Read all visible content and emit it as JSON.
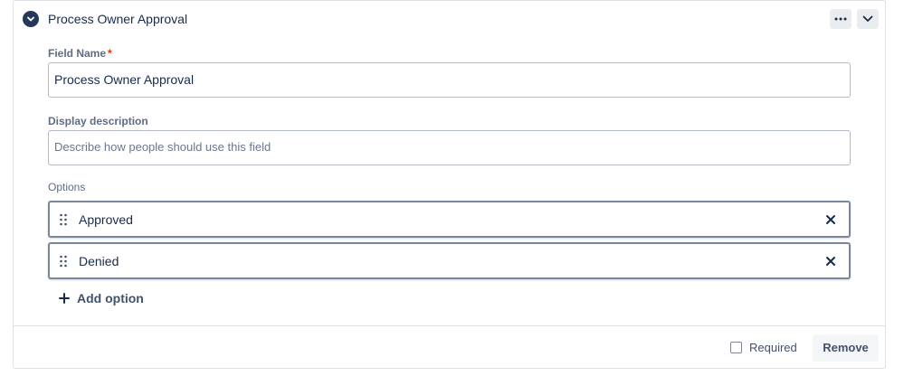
{
  "section": {
    "title": "Process Owner Approval",
    "more_icon": "more-horizontal-icon",
    "chevron_icon": "chevron-down-icon",
    "collapse_icon": "chevron-down-circle-icon"
  },
  "field_name": {
    "label": "Field Name",
    "required_mark": "*",
    "value": "Process Owner Approval"
  },
  "display_description": {
    "label": "Display description",
    "placeholder": "Describe how people should use this field"
  },
  "options": {
    "label": "Options",
    "items": [
      {
        "label": "Approved"
      },
      {
        "label": "Denied"
      }
    ],
    "add_label": "Add option"
  },
  "footer": {
    "required_label": "Required",
    "required_checked": false,
    "remove_label": "Remove"
  },
  "colors": {
    "accent_dark": "#253858",
    "required_star": "#de350b",
    "text": "#172b4d",
    "muted": "#5e6c84"
  }
}
